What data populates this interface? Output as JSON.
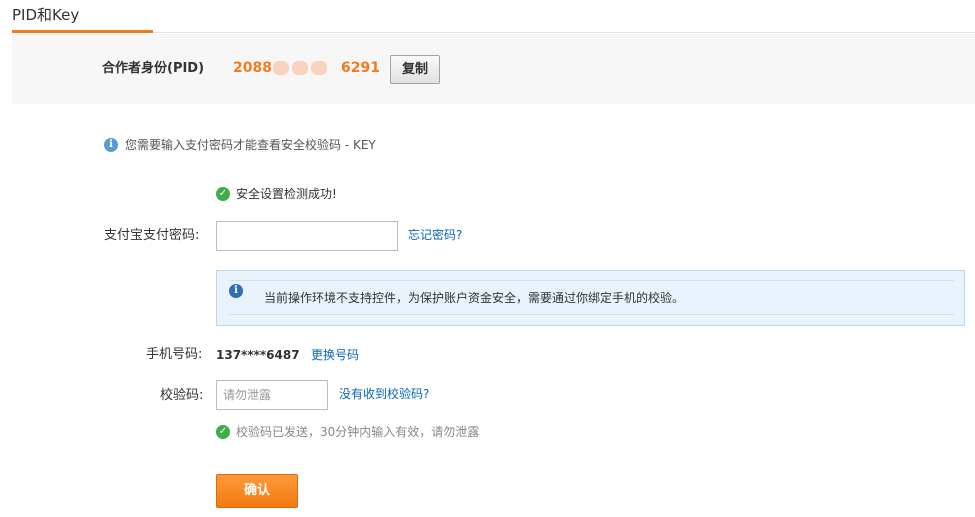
{
  "header": {
    "tab_title": "PID和Key"
  },
  "pid": {
    "label": "合作者身份(PID)",
    "value_prefix": "2088",
    "value_suffix": "6291",
    "copy_label": "复制"
  },
  "info": {
    "text": "您需要输入支付密码才能查看安全校验码 - KEY"
  },
  "security": {
    "success_text": "安全设置检测成功!"
  },
  "password": {
    "label": "支付宝支付密码:",
    "value": "",
    "forgot_label": "忘记密码?"
  },
  "notice": {
    "text": "当前操作环境不支持控件，为保护账户资金安全，需要通过你绑定手机的校验。"
  },
  "phone": {
    "label": "手机号码:",
    "value": "137****6487",
    "change_label": "更换号码"
  },
  "code": {
    "label": "校验码:",
    "placeholder": "请勿泄露",
    "value": "",
    "no_code_label": "没有收到校验码?"
  },
  "sent_note": {
    "text": "校验码已发送，30分钟内输入有效，请勿泄露"
  },
  "confirm": {
    "label": "确认"
  },
  "colors": {
    "accent": "#f37b1d",
    "link": "#0a67b2",
    "success": "#3fae49",
    "info": "#5b9bd5"
  },
  "icons": {
    "info": "info-circle-icon",
    "success": "check-circle-icon"
  }
}
